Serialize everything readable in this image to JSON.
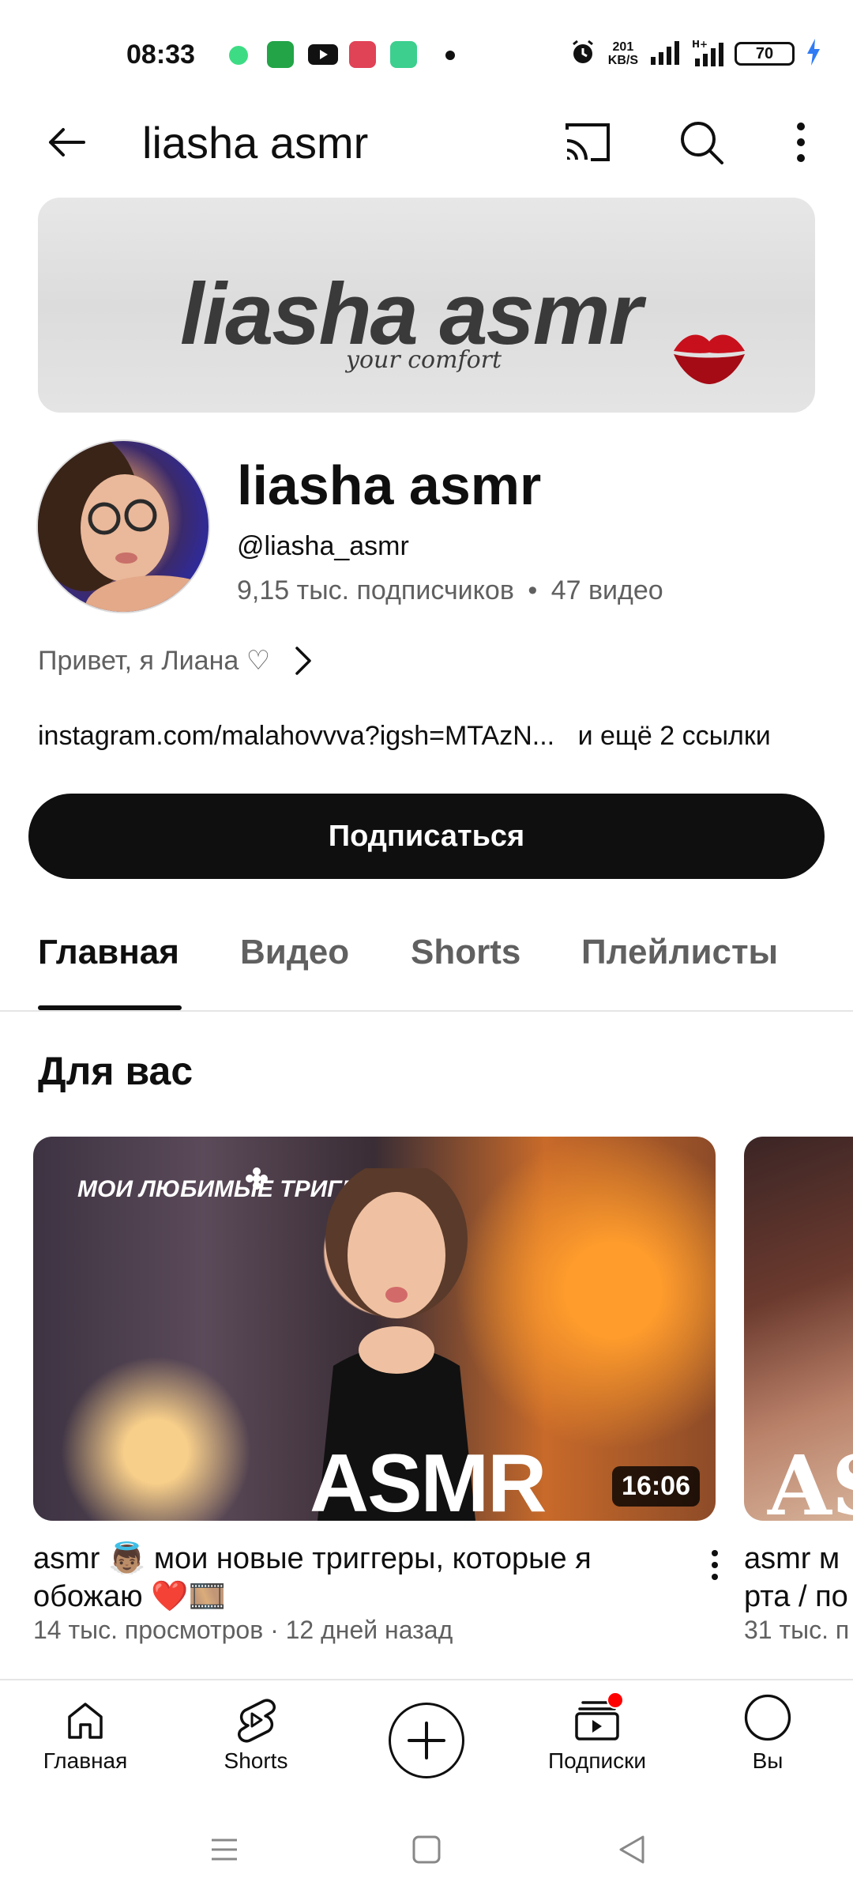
{
  "status_bar": {
    "time": "08:33",
    "network_speed_value": "201",
    "network_speed_unit": "KB/S",
    "battery_level": "70",
    "icons": [
      "chat-bubble-icon",
      "cart-app-icon",
      "youtube-icon",
      "screen-record-icon",
      "battery-saver-icon",
      "alarm-icon",
      "signal-icon",
      "signal-hplus-icon",
      "charging-bolt-icon"
    ]
  },
  "topbar": {
    "title": "liasha asmr",
    "back_icon": "arrow-left-icon",
    "cast_icon": "cast-icon",
    "search_icon": "search-icon",
    "more_icon": "more-vertical-icon"
  },
  "banner": {
    "title": "liasha asmr",
    "subtitle": "your comfort",
    "decor_icon": "lips-kiss-icon"
  },
  "channel": {
    "name": "liasha asmr",
    "handle": "@liasha_asmr",
    "subscribers": "9,15 тыс. подписчиков",
    "separator": "•",
    "videos": "47 видео",
    "description": "Привет, я Лиана ♡",
    "link": "instagram.com/malahovvva?igsh=MTAzN...",
    "more_links": "и ещё 2 ссылки",
    "subscribe_label": "Подписаться"
  },
  "tabs": [
    {
      "label": "Главная",
      "active": true
    },
    {
      "label": "Видео",
      "active": false
    },
    {
      "label": "Shorts",
      "active": false
    },
    {
      "label": "Плейлисты",
      "active": false
    }
  ],
  "section": {
    "title": "Для вас"
  },
  "videos": [
    {
      "thumb_caption": "МОИ ЛЮБИМЫЕ ТРИГГЕРЫ",
      "thumb_big": "ASMR",
      "duration": "16:06",
      "title": "asmr 👼🏽 мои новые триггеры, которые я обожаю ❤️🎞️",
      "meta": "14 тыс. просмотров · 12 дней назад"
    },
    {
      "thumb_big": "AS",
      "title": "asmr м",
      "title_line2": "рта / по",
      "meta": "31 тыс. п"
    }
  ],
  "bottom_nav": [
    {
      "label": "Главная",
      "icon": "home-icon"
    },
    {
      "label": "Shorts",
      "icon": "shorts-icon"
    },
    {
      "label": "",
      "icon": "create-plus-icon"
    },
    {
      "label": "Подписки",
      "icon": "subscriptions-icon"
    },
    {
      "label": "Вы",
      "icon": "profile-icon"
    }
  ],
  "colors": {
    "accent": "#0f0f0f",
    "secondary_text": "#606060",
    "notification": "#ff0000"
  }
}
